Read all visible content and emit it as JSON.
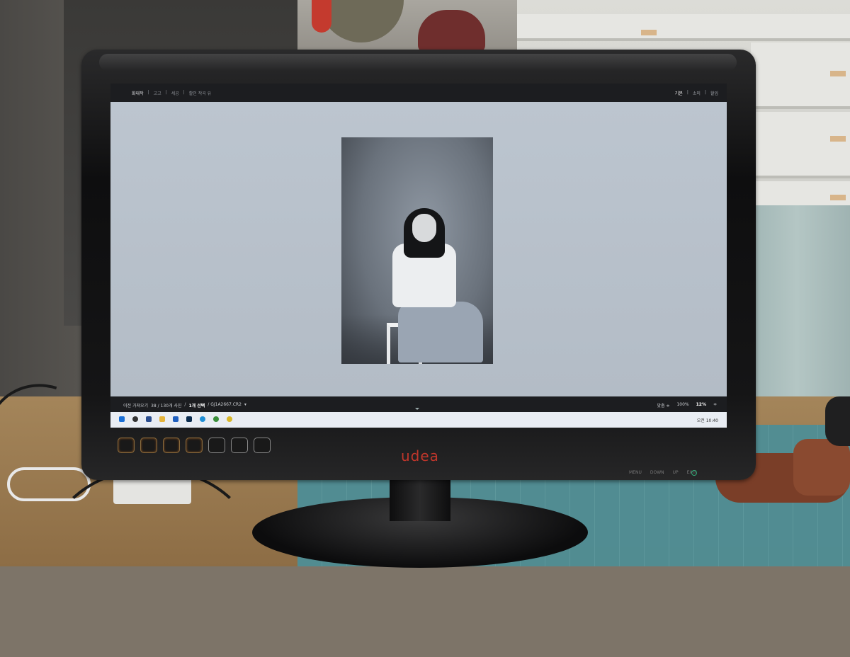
{
  "screen": {
    "topbar": {
      "nav": [
        "화대작",
        "고고",
        "세공",
        "활인 작곡 유"
      ],
      "active_nav": 0,
      "modes": [
        "기본",
        "소미",
        "할임"
      ],
      "active_mode": 0
    },
    "photo": {
      "subject": "black-and-white portrait"
    },
    "statusbar": {
      "prefix": "이전 가져오기",
      "count": "38 / 130개 사진",
      "selected": "1개 선택",
      "filename": "/ GJ1A2667.CR2",
      "sort": "맞춤 ≑",
      "zoom1": "100%",
      "zoom2": "12%"
    },
    "taskbar": {
      "clock": "오전 10:40",
      "icons": [
        "windows-icon",
        "search-icon",
        "files-icon",
        "folder-icon",
        "mail-icon",
        "lightroom-icon",
        "edge-icon",
        "chrome-icon",
        "app-icon"
      ]
    }
  },
  "monitor": {
    "brand": "udea",
    "controls": [
      "MENU",
      "DOWN",
      "UP",
      "EXIT"
    ]
  }
}
